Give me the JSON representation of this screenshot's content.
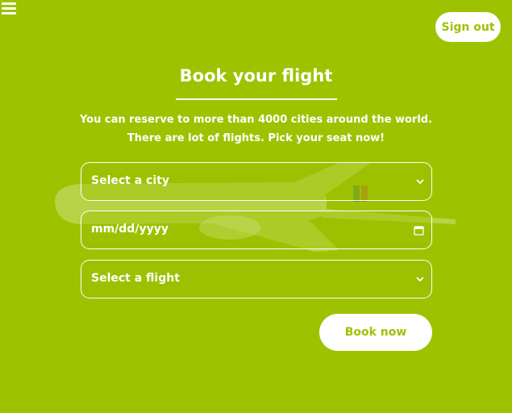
{
  "header": {
    "menu_icon": "hamburger-menu-icon",
    "sign_out_label": "Sign out"
  },
  "main": {
    "title": "Book your flight",
    "subtitle_line1": "You can reserve to more than 4000 cities around the world.",
    "subtitle_line2": "There are lot of flights. Pick your seat now!",
    "background_image": "airplane-photo"
  },
  "form": {
    "city_select": {
      "value": "Select a city",
      "icon": "chevron-down-icon"
    },
    "date_input": {
      "placeholder": "mm/dd/yyyy",
      "icon": "calendar-icon"
    },
    "flight_select": {
      "value": "Select a flight",
      "icon": "chevron-down-icon"
    },
    "submit_label": "Book now"
  },
  "colors": {
    "background": "#9dc200",
    "foreground": "#ffffff"
  }
}
